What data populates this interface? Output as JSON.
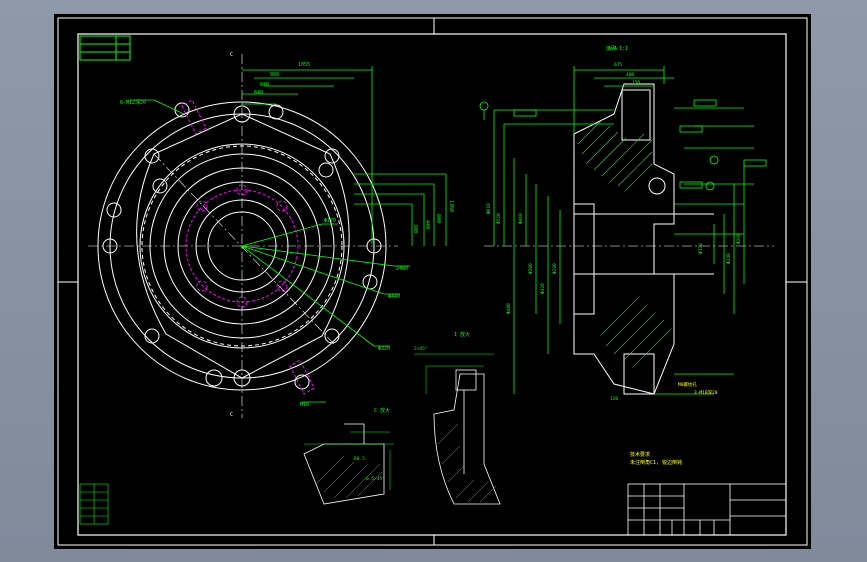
{
  "drawing": {
    "title": "",
    "scale_label": "比例 1:1",
    "section_label_main": "A-A",
    "section_label_detail_c": "I 放大",
    "section_label_detail_d": "C 放大",
    "corner_note": "",
    "top_left_table": [
      "",
      "",
      ""
    ],
    "tech_note_title": "技术要求",
    "tech_note_line": "未注倒角C1, 锐边倒钝",
    "title_block": {
      "name": "",
      "code": "",
      "material": "",
      "company": ""
    }
  },
  "colors": {
    "background": "#000000",
    "frame": "#ffffff",
    "dimension": "#00ff00",
    "centerline": "#ffffff",
    "bolt_circle": "#ff00ff",
    "annotation": "#ffff00"
  }
}
